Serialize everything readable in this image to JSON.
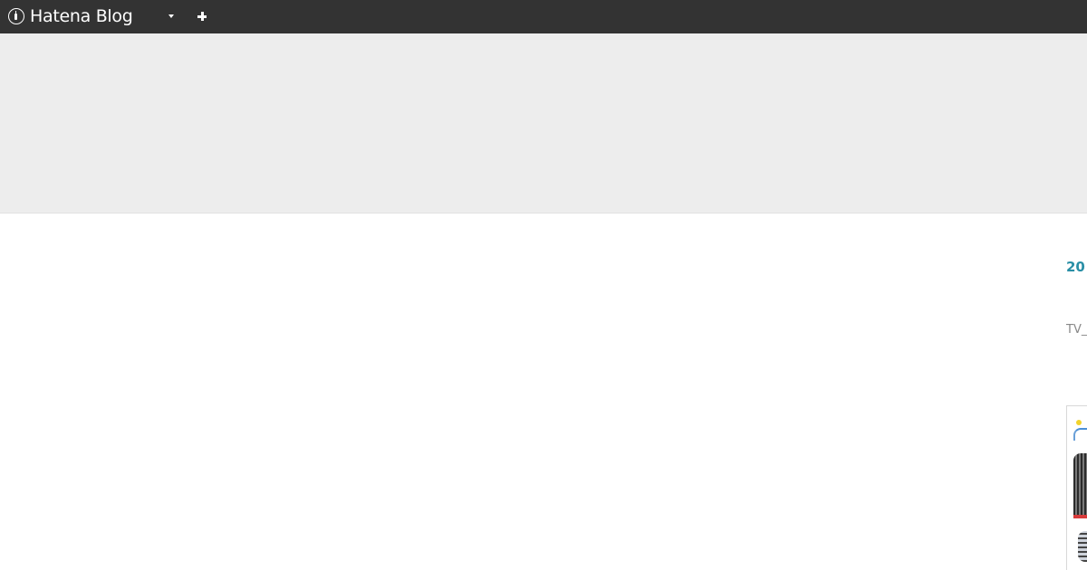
{
  "topbar": {
    "logo_text": "Hatena Blog",
    "background_color": "#333333"
  },
  "banner": {
    "background_color": "#ededed"
  },
  "entry": {
    "date": "20",
    "title": "",
    "category": "TV_",
    "heading": "",
    "date_color": "#2a8fa6"
  }
}
